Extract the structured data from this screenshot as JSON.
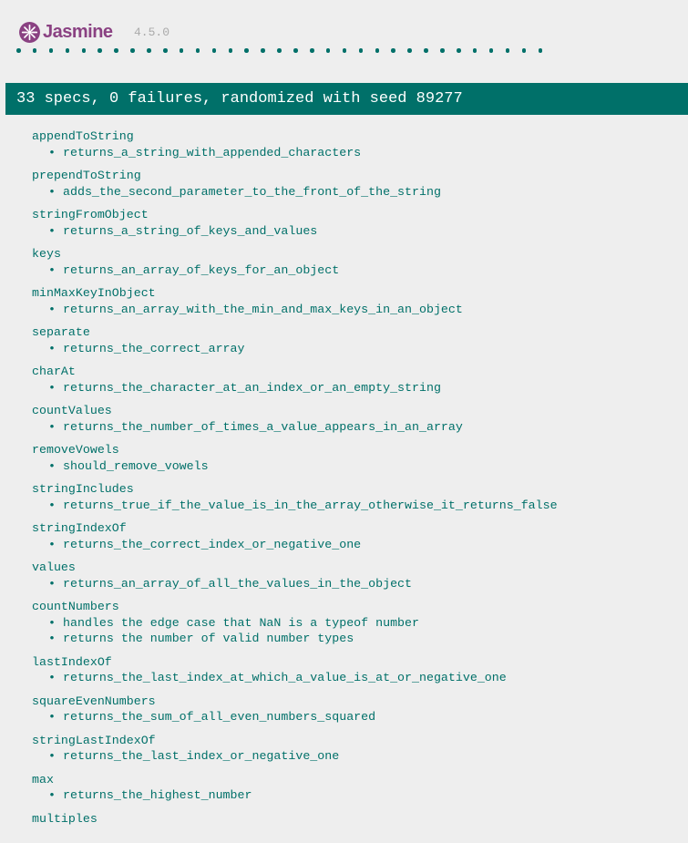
{
  "app": {
    "logo_text": "Jasmine",
    "version": "4.5.0",
    "logo_icon": "jasmine-flower-icon",
    "colors": {
      "brand": "#8a4182",
      "passed": "#007069",
      "background": "#eeeeee"
    }
  },
  "summary": {
    "text": "33 specs, 0 failures, randomized with seed 89277"
  },
  "suites": [
    {
      "title": "appendToString",
      "specs": [
        "returns_a_string_with_appended_characters"
      ]
    },
    {
      "title": "prependToString",
      "specs": [
        "adds_the_second_parameter_to_the_front_of_the_string"
      ]
    },
    {
      "title": "stringFromObject",
      "specs": [
        "returns_a_string_of_keys_and_values"
      ]
    },
    {
      "title": "keys",
      "specs": [
        "returns_an_array_of_keys_for_an_object"
      ]
    },
    {
      "title": "minMaxKeyInObject",
      "specs": [
        "returns_an_array_with_the_min_and_max_keys_in_an_object"
      ]
    },
    {
      "title": "separate",
      "specs": [
        "returns_the_correct_array"
      ]
    },
    {
      "title": "charAt",
      "specs": [
        "returns_the_character_at_an_index_or_an_empty_string"
      ]
    },
    {
      "title": "countValues",
      "specs": [
        "returns_the_number_of_times_a_value_appears_in_an_array"
      ]
    },
    {
      "title": "removeVowels",
      "specs": [
        "should_remove_vowels"
      ]
    },
    {
      "title": "stringIncludes",
      "specs": [
        "returns_true_if_the_value_is_in_the_array_otherwise_it_returns_false"
      ]
    },
    {
      "title": "stringIndexOf",
      "specs": [
        "returns_the_correct_index_or_negative_one"
      ]
    },
    {
      "title": "values",
      "specs": [
        "returns_an_array_of_all_the_values_in_the_object"
      ]
    },
    {
      "title": "countNumbers",
      "specs": [
        "handles the edge case that NaN is a typeof number",
        "returns the number of valid number types"
      ]
    },
    {
      "title": "lastIndexOf",
      "specs": [
        "returns_the_last_index_at_which_a_value_is_at_or_negative_one"
      ]
    },
    {
      "title": "squareEvenNumbers",
      "specs": [
        "returns_the_sum_of_all_even_numbers_squared"
      ]
    },
    {
      "title": "stringLastIndexOf",
      "specs": [
        "returns_the_last_index_or_negative_one"
      ]
    },
    {
      "title": "max",
      "specs": [
        "returns_the_highest_number"
      ]
    },
    {
      "title": "multiples",
      "specs": []
    }
  ]
}
